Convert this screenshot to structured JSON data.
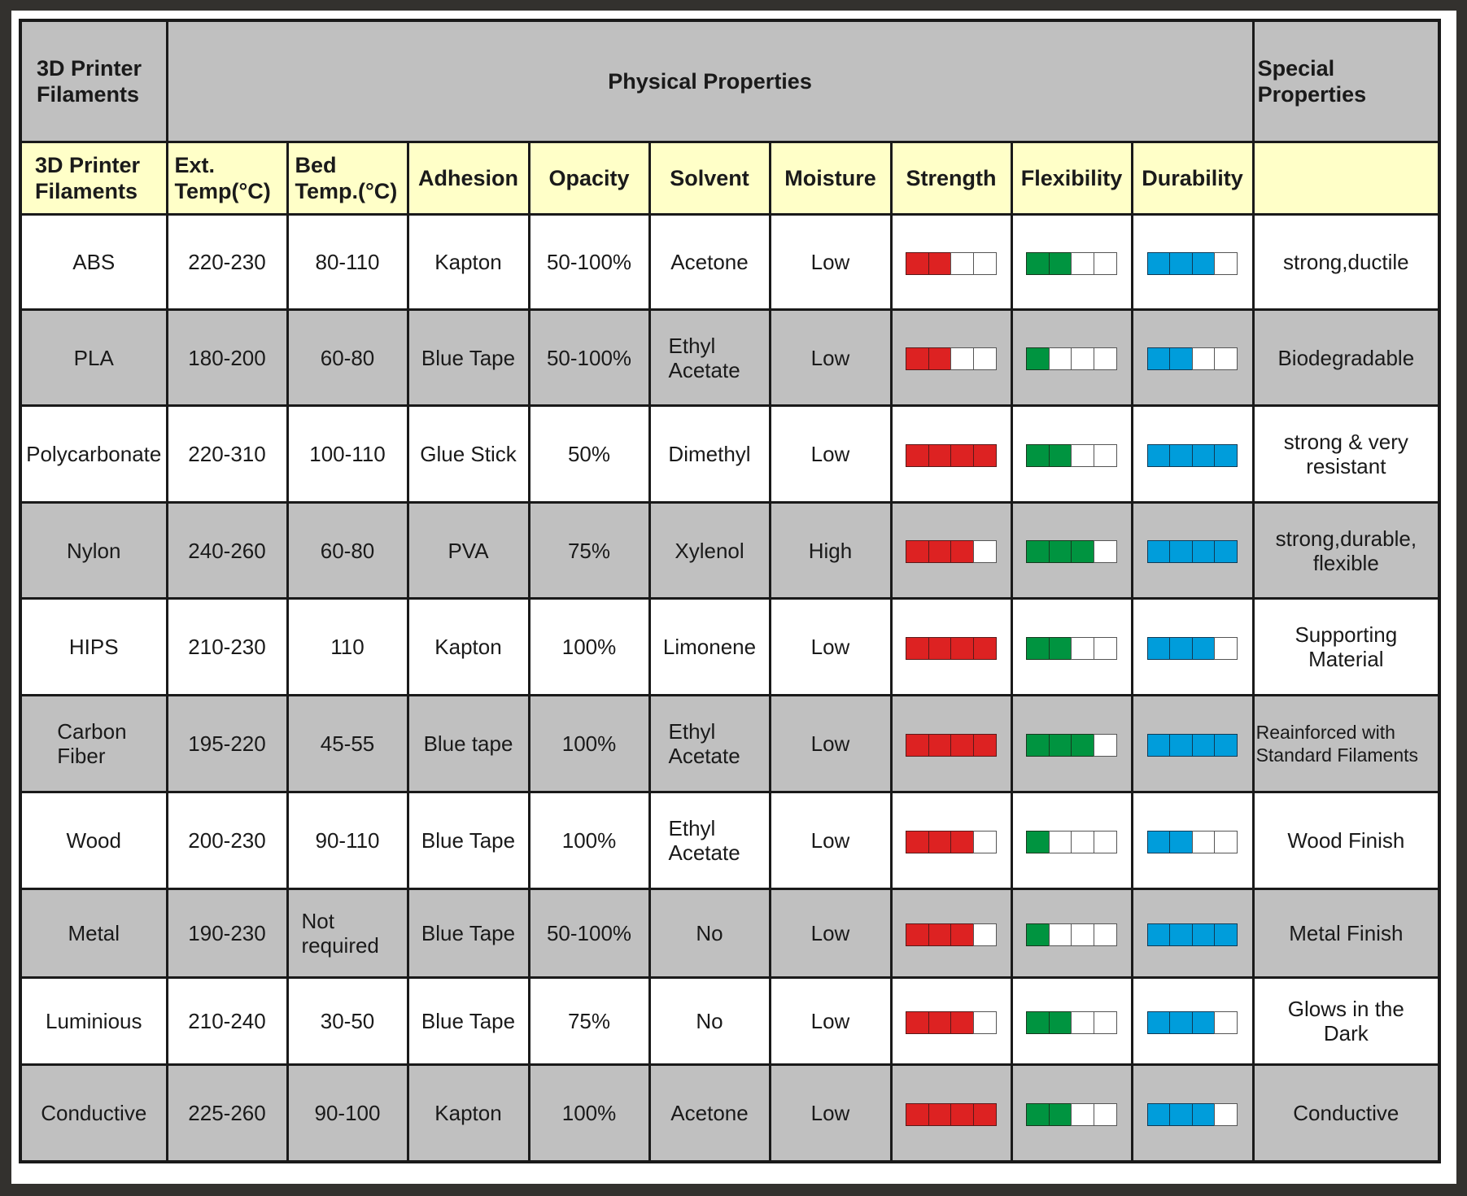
{
  "header": {
    "row1": {
      "first": "3D Printer Filaments",
      "group": "Physical Properties",
      "special": "Special Properties"
    },
    "columns": [
      "3D Printer Filaments",
      "Ext. Temp(°C)",
      "Bed Temp.(°C)",
      "Adhesion",
      "Opacity",
      "Solvent",
      "Moisture",
      "Strength",
      "Flexibility",
      "Durability",
      ""
    ]
  },
  "rating_scale_max": 4,
  "colors": {
    "strength": "#dd2222",
    "flexibility": "#009440",
    "durability": "#009ddb",
    "header_grey": "#c0c0c0",
    "header_yellow": "#ffffc8",
    "row_grey": "#c0c0c0",
    "frame": "#33312e"
  },
  "rows": [
    {
      "filament": "ABS",
      "ext_temp": "220-230",
      "bed_temp": "80-110",
      "adhesion": "Kapton",
      "opacity": "50-100%",
      "solvent": "Acetone",
      "moisture": "Low",
      "strength": 2,
      "flexibility": 2,
      "durability": 3,
      "special": "strong,ductile"
    },
    {
      "filament": "PLA",
      "ext_temp": "180-200",
      "bed_temp": "60-80",
      "adhesion": "Blue Tape",
      "opacity": "50-100%",
      "solvent": "Ethyl Acetate",
      "moisture": "Low",
      "strength": 2,
      "flexibility": 1,
      "durability": 2,
      "special": "Biodegradable"
    },
    {
      "filament": "Polycarbonate",
      "ext_temp": "220-310",
      "bed_temp": "100-110",
      "adhesion": "Glue Stick",
      "opacity": "50%",
      "solvent": "Dimethyl",
      "moisture": "Low",
      "strength": 4,
      "flexibility": 2,
      "durability": 4,
      "special": "strong & very resistant"
    },
    {
      "filament": "Nylon",
      "ext_temp": "240-260",
      "bed_temp": "60-80",
      "adhesion": "PVA",
      "opacity": "75%",
      "solvent": "Xylenol",
      "moisture": "High",
      "strength": 3,
      "flexibility": 3,
      "durability": 4,
      "special": "strong,durable, flexible"
    },
    {
      "filament": "HIPS",
      "ext_temp": "210-230",
      "bed_temp": "110",
      "adhesion": "Kapton",
      "opacity": "100%",
      "solvent": "Limonene",
      "moisture": "Low",
      "strength": 4,
      "flexibility": 2,
      "durability": 3,
      "special": "Supporting Material"
    },
    {
      "filament": "Carbon Fiber",
      "ext_temp": "195-220",
      "bed_temp": "45-55",
      "adhesion": "Blue tape",
      "opacity": "100%",
      "solvent": "Ethyl Acetate",
      "moisture": "Low",
      "strength": 4,
      "flexibility": 3,
      "durability": 4,
      "special": "Reainforced with Standard Filaments"
    },
    {
      "filament": "Wood",
      "ext_temp": "200-230",
      "bed_temp": "90-110",
      "adhesion": "Blue Tape",
      "opacity": "100%",
      "solvent": "Ethyl Acetate",
      "moisture": "Low",
      "strength": 3,
      "flexibility": 1,
      "durability": 2,
      "special": "Wood Finish"
    },
    {
      "filament": "Metal",
      "ext_temp": "190-230",
      "bed_temp": "Not required",
      "adhesion": "Blue Tape",
      "opacity": "50-100%",
      "solvent": "No",
      "moisture": "Low",
      "strength": 3,
      "flexibility": 1,
      "durability": 4,
      "special": "Metal Finish"
    },
    {
      "filament": "Luminious",
      "ext_temp": "210-240",
      "bed_temp": "30-50",
      "adhesion": "Blue Tape",
      "opacity": "75%",
      "solvent": "No",
      "moisture": "Low",
      "strength": 3,
      "flexibility": 2,
      "durability": 3,
      "special": "Glows in the Dark"
    },
    {
      "filament": "Conductive",
      "ext_temp": "225-260",
      "bed_temp": "90-100",
      "adhesion": "Kapton",
      "opacity": "100%",
      "solvent": "Acetone",
      "moisture": "Low",
      "strength": 4,
      "flexibility": 2,
      "durability": 3,
      "special": "Conductive"
    }
  ]
}
